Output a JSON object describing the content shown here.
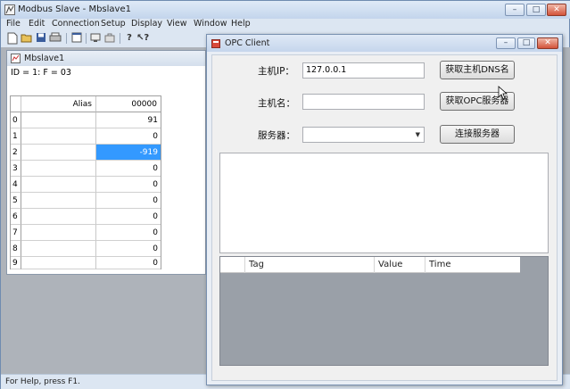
{
  "main_window": {
    "title": "Modbus Slave - Mbslave1",
    "caption_buttons": {
      "minimize": "–",
      "maximize": "□",
      "close": "✕"
    }
  },
  "menu": [
    "File",
    "Edit",
    "Connection",
    "Setup",
    "Display",
    "View",
    "Window",
    "Help"
  ],
  "toolbar_icons": [
    "new-file-icon",
    "open-folder-icon",
    "save-icon",
    "print-icon",
    "window-icon",
    "connect-icon",
    "disconnect-icon",
    "help-icon",
    "context-help-icon"
  ],
  "status_bar": {
    "text": "For Help, press F1."
  },
  "mbslave": {
    "title": "Mbslave1",
    "id_line": "ID = 1: F = 03",
    "columns": {
      "alias": "Alias",
      "address": "00000"
    },
    "rows": [
      {
        "index": "0",
        "value": "91"
      },
      {
        "index": "1",
        "value": "0"
      },
      {
        "index": "2",
        "value": "-919"
      },
      {
        "index": "3",
        "value": "0"
      },
      {
        "index": "4",
        "value": "0"
      },
      {
        "index": "5",
        "value": "0"
      },
      {
        "index": "6",
        "value": "0"
      },
      {
        "index": "7",
        "value": "0"
      },
      {
        "index": "8",
        "value": "0"
      },
      {
        "index": "9",
        "value": "0"
      }
    ]
  },
  "opc": {
    "title": "OPC Client",
    "caption_buttons": {
      "minimize": "–",
      "maximize": "□",
      "close": "✕"
    },
    "host_ip_label": "主机IP：",
    "host_ip_value": "127.0.0.1",
    "host_name_label": "主机名：",
    "host_name_value": "",
    "server_label": "服务器：",
    "server_value": "",
    "btn_get_dns": "获取主机DNS名",
    "btn_get_opc": "获取OPC服务器",
    "btn_connect": "连接服务器",
    "list_columns": {
      "tag": "Tag",
      "value": "Value",
      "time": "Time"
    }
  }
}
